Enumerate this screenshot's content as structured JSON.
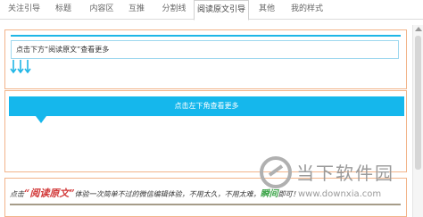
{
  "tabs": [
    {
      "label": "关注引导"
    },
    {
      "label": "标题"
    },
    {
      "label": "内容区"
    },
    {
      "label": "互推"
    },
    {
      "label": "分割线"
    },
    {
      "label": "阅读原文引导",
      "active": true
    },
    {
      "label": "其他"
    },
    {
      "label": "我的样式"
    }
  ],
  "block1": {
    "text": "点击下方“阅读原文”查看更多",
    "arrow_icon": "down-arrows-icon",
    "accent_color": "#1fb6e6"
  },
  "block2": {
    "text": "点击左下角查看更多",
    "accent_color": "#15b7ec"
  },
  "block3": {
    "prefix": "点击",
    "read_original": "“阅读原文”",
    "middle": "体验一次简单不过的微信编辑体验，不用太久，不用太难，",
    "quick": "瞬间",
    "suffix": "即可！"
  },
  "watermark": {
    "title": "当下软件园",
    "url": "www.downxia.com"
  },
  "colors": {
    "frame_border": "#f2b48a",
    "red_accent": "#d23a3a",
    "green_accent": "#3ea54a"
  }
}
